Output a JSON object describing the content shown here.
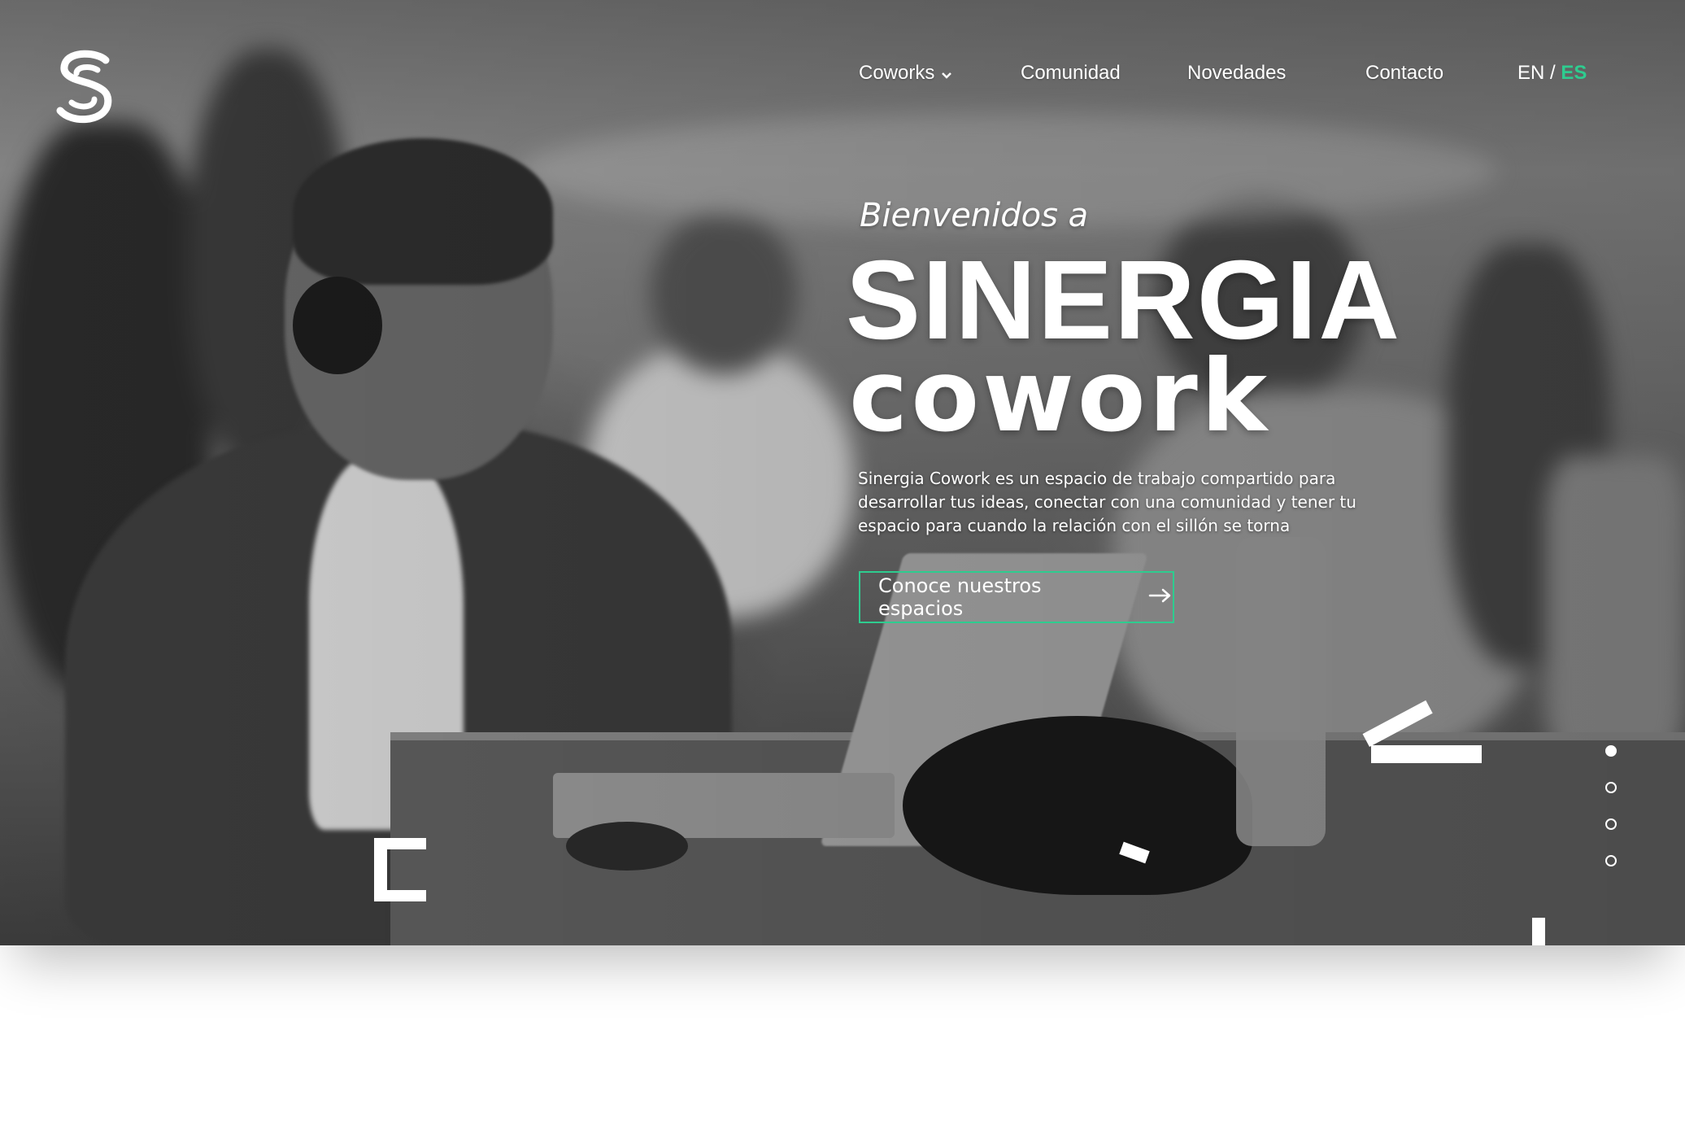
{
  "header": {
    "logo_icon": "sinergia-s-logo",
    "nav": [
      {
        "label": "Coworks",
        "has_dropdown": true
      },
      {
        "label": "Comunidad"
      },
      {
        "label": "Novedades"
      },
      {
        "label": "Contacto"
      }
    ],
    "languages": {
      "en": "EN",
      "separator": "/",
      "es": "ES",
      "active": "ES"
    }
  },
  "hero": {
    "welcome": "Bienvenidos a",
    "brand_line1": "SINERGIA",
    "brand_line2": "cowork",
    "description": "Sinergia Cowork es un espacio de trabajo compartido para desarrollar tus ideas, conectar con una comunidad y tener tu espacio para cuando la relación con el sillón se torna",
    "cta_label": "Conoce nuestros espacios",
    "cta_icon": "arrow-right-icon",
    "slides": {
      "total": 4,
      "active_index": 0
    }
  },
  "colors": {
    "accent": "#2ecc8f",
    "text": "#ffffff"
  }
}
